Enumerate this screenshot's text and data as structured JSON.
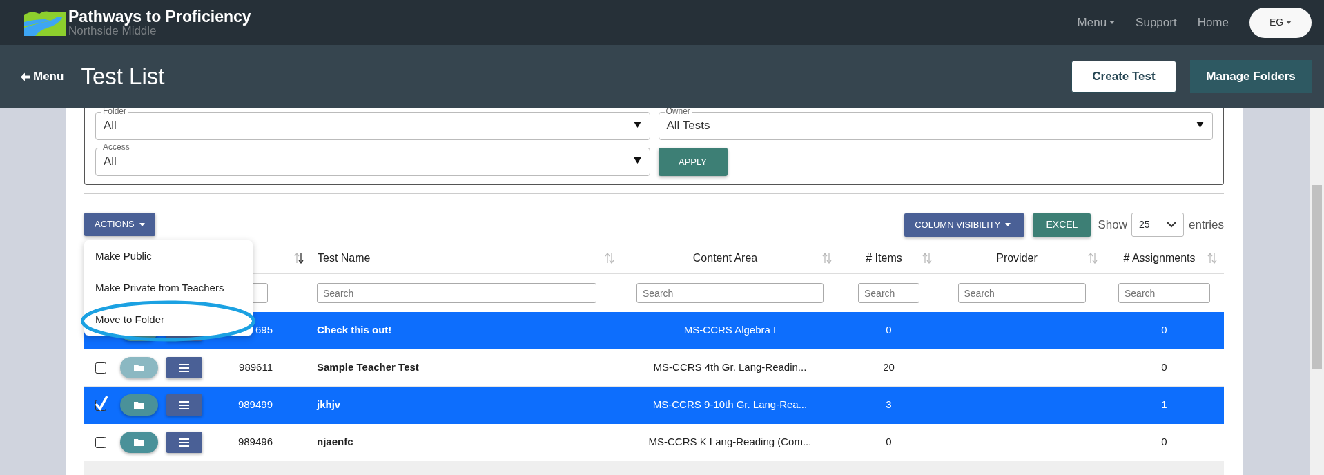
{
  "header": {
    "title": "Pathways to Proficiency",
    "subtitle": "Northside Middle",
    "nav": [
      {
        "label": "Menu",
        "dropdown": true
      },
      {
        "label": "Support",
        "dropdown": false
      },
      {
        "label": "Home",
        "dropdown": false
      }
    ],
    "user": {
      "initials": "EG"
    }
  },
  "subheader": {
    "back": "Menu",
    "title": "Test List",
    "buttons": [
      {
        "label": "Create Test",
        "kind": "outline"
      },
      {
        "label": "Manage Folders",
        "kind": "solid"
      }
    ]
  },
  "filters": [
    {
      "label": "Folder",
      "value": "All"
    },
    {
      "label": "Owner",
      "value": "All Tests"
    },
    {
      "label": "Access",
      "value": "All"
    }
  ],
  "apply": "APPLY",
  "actions": {
    "label": "ACTIONS",
    "expanded": true,
    "items": [
      {
        "label": "Make Public",
        "circled": false
      },
      {
        "label": "Make Private from Teachers",
        "circled": false
      },
      {
        "label": "Move to Folder",
        "circled": true
      }
    ]
  },
  "toolbar": {
    "column_visibility": "COLUMN VISIBILITY",
    "excel": "EXCEL",
    "show": "Show",
    "page_size": "25",
    "entries": "entries"
  },
  "table": {
    "columns": [
      {
        "sorted": true
      },
      {
        "label": "Test Name",
        "placeholder": "Search",
        "sorted": false
      },
      {
        "label": "Content Area",
        "placeholder": "Search",
        "sorted": false
      },
      {
        "label": "# Items",
        "placeholder": "Search",
        "sorted": false
      },
      {
        "label": "Provider",
        "placeholder": "Search",
        "sorted": false
      },
      {
        "label": "# Assignments",
        "placeholder": "Search",
        "sorted": false
      }
    ],
    "rows": [
      {
        "id": "695",
        "name": "Check this out!",
        "content_area": "MS-CCRS Algebra I",
        "items": "0",
        "assignments": "0",
        "selected": true,
        "folder_disabled": false
      },
      {
        "id": "989611",
        "name": "Sample Teacher Test",
        "content_area": "MS-CCRS 4th Gr. Lang-Readin...",
        "items": "20",
        "assignments": "0",
        "selected": false,
        "checked": false,
        "folder_disabled": true
      },
      {
        "id": "989499",
        "name": "jkhjv",
        "content_area": "MS-CCRS 9-10th Gr. Lang-Rea...",
        "items": "3",
        "assignments": "1",
        "selected": true,
        "checked": true,
        "folder_disabled": false
      },
      {
        "id": "989496",
        "name": "njaenfc",
        "content_area": "MS-CCRS K Lang-Reading (Com...",
        "items": "0",
        "assignments": "0",
        "selected": false,
        "checked": false,
        "folder_disabled": false
      }
    ]
  }
}
